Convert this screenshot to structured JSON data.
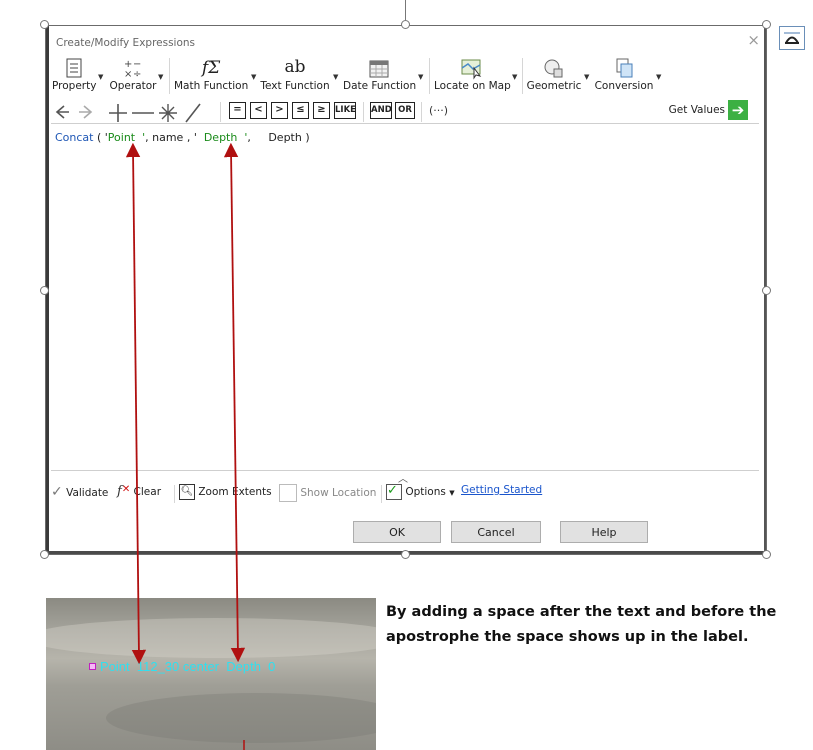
{
  "dialog": {
    "title": "Create/Modify Expressions",
    "close_glyph": "×"
  },
  "toolbar": {
    "items": [
      {
        "label": "Property",
        "icon": "property-list-icon"
      },
      {
        "label": "Operator",
        "icon": "operator-icon"
      },
      {
        "label": "Math Function",
        "icon": "math-function-icon",
        "glyph": "fΣ"
      },
      {
        "label": "Text Function",
        "icon": "text-function-icon",
        "glyph": "ab"
      },
      {
        "label": "Date Function",
        "icon": "calendar-icon"
      },
      {
        "label": "Locate on Map",
        "icon": "map-locate-icon"
      },
      {
        "label": "Geometric",
        "icon": "geometric-icon"
      },
      {
        "label": "Conversion",
        "icon": "conversion-icon"
      }
    ]
  },
  "operators": {
    "like": "LIKE",
    "and": "AND",
    "or": "OR",
    "group": "(···)",
    "get_values": "Get Values"
  },
  "expression": {
    "fn": "Concat",
    "p1": " ( '",
    "s1": "Point  '",
    "p2": ", name , '",
    "s2": "  Depth  '",
    "p3": ",     Depth )"
  },
  "bottom_tools": {
    "validate": "Validate",
    "clear": "Clear",
    "zoom_extents": "Zoom Extents",
    "show_location": "Show Location",
    "options": "Options",
    "getting_started": "Getting Started"
  },
  "buttons": {
    "ok": "OK",
    "cancel": "Cancel",
    "help": "Help"
  },
  "map_label": {
    "text": "Point  112_30 center  Depth  0"
  },
  "caption": "By adding a space after the text and before the apostrophe the space shows up in the label.",
  "colors": {
    "function": "#1f57b5",
    "string": "#1a8b1a",
    "arrow": "#b01010",
    "label_text": "#2fe0f0",
    "get_values_arrow": "#3cb043"
  }
}
